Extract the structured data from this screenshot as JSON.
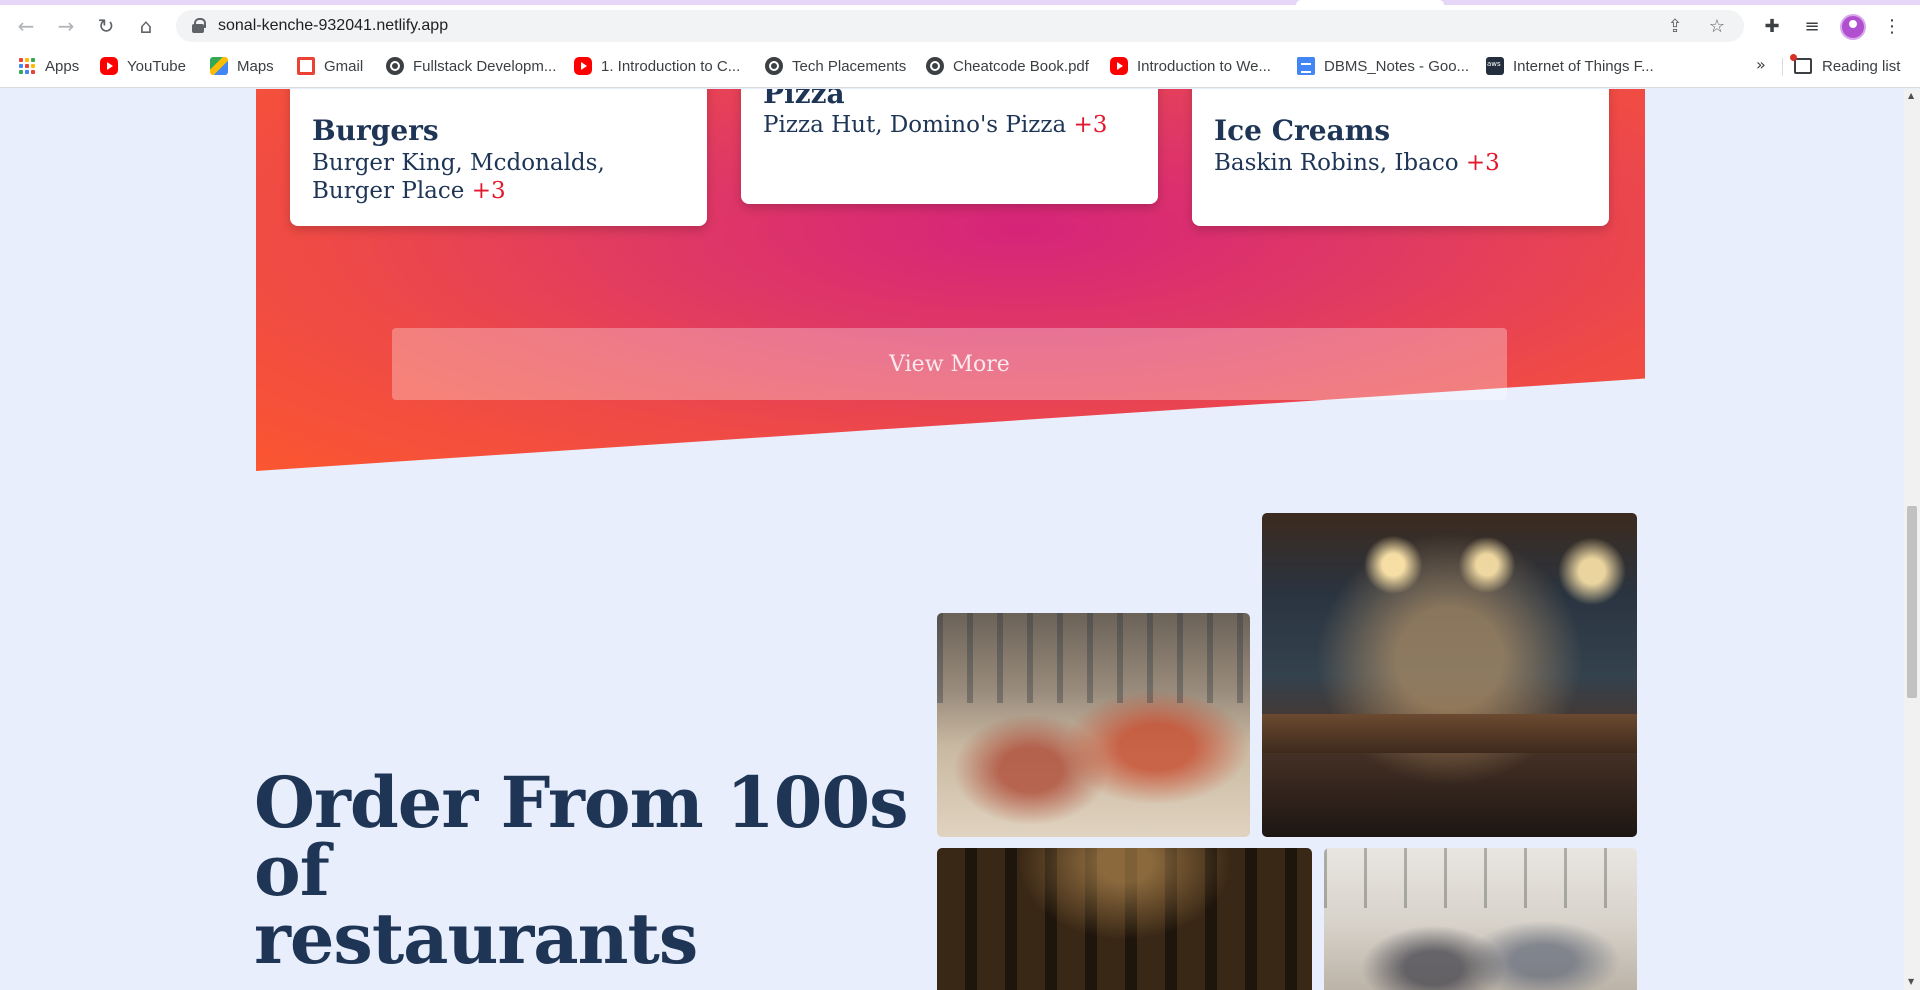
{
  "browser": {
    "url": "sonal-kenche-932041.netlify.app",
    "bookmarks": [
      {
        "label": "Apps",
        "icon": "apps-grid-icon"
      },
      {
        "label": "YouTube",
        "icon": "youtube-icon"
      },
      {
        "label": "Maps",
        "icon": "maps-icon"
      },
      {
        "label": "Gmail",
        "icon": "gmail-icon"
      },
      {
        "label": "Fullstack Developm...",
        "icon": "globe-icon"
      },
      {
        "label": "1. Introduction to C...",
        "icon": "youtube-icon"
      },
      {
        "label": "Tech Placements",
        "icon": "globe-icon"
      },
      {
        "label": "Cheatcode Book.pdf",
        "icon": "globe-icon"
      },
      {
        "label": "Introduction to We...",
        "icon": "youtube-icon"
      },
      {
        "label": "DBMS_Notes - Goo...",
        "icon": "docs-icon"
      },
      {
        "label": "Internet of Things F...",
        "icon": "aws-icon"
      }
    ],
    "bookmarks_overflow": "»",
    "reading_list": "Reading list"
  },
  "cards": [
    {
      "title": "Burgers",
      "brands": "Burger King, Mcdonalds, Burger Place",
      "more": "+3"
    },
    {
      "title": "Pizza",
      "brands": "Pizza Hut, Domino's Pizza",
      "more": "+3"
    },
    {
      "title": "Ice Creams",
      "brands": "Baskin Robins, Ibaco",
      "more": "+3"
    }
  ],
  "view_more": "View More",
  "order_section": {
    "heading_line1": "Order From 100s of",
    "heading_line2": "restaurants"
  },
  "colors": {
    "gradient_pink": "#d6247a",
    "gradient_orange": "#fb5630",
    "heading_navy": "#1e3556",
    "accent_red": "#e3172b",
    "page_bg": "#e8eefc"
  }
}
